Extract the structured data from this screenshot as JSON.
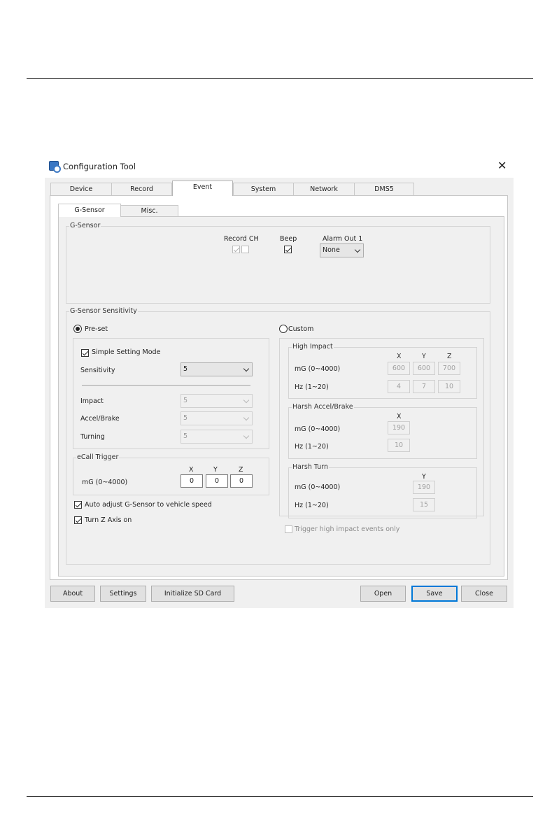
{
  "window": {
    "title": "Configuration Tool",
    "icon": "app-gear-icon"
  },
  "tabs": [
    "Device",
    "Record",
    "Event",
    "System",
    "Network",
    "DMS5"
  ],
  "active_tab": "Event",
  "subtabs": [
    "G-Sensor",
    "Misc."
  ],
  "active_subtab": "G-Sensor",
  "gsensor_group": {
    "label": "G-Sensor",
    "record_ch_label": "Record CH",
    "record_ch": [
      true,
      false
    ],
    "beep_label": "Beep",
    "beep": true,
    "alarm_label": "Alarm Out 1",
    "alarm_value": "None"
  },
  "sensitivity_group": {
    "label": "G-Sensor Sensitivity",
    "preset_label": "Pre-set",
    "preset_selected": true,
    "custom_label": "Custom",
    "custom_selected": false,
    "simple_mode_label": "Simple Setting Mode",
    "simple_mode": true,
    "sensitivity_label": "Sensitivity",
    "sensitivity_value": "5",
    "impact_label": "Impact",
    "impact_value": "5",
    "accel_label": "Accel/Brake",
    "accel_value": "5",
    "turning_label": "Turning",
    "turning_value": "5",
    "ecall": {
      "label": "eCall Trigger",
      "row_label": "mG (0~4000)",
      "x_label": "X",
      "y_label": "Y",
      "z_label": "Z",
      "x": "0",
      "y": "0",
      "z": "0"
    },
    "auto_adjust_label": "Auto adjust G-Sensor to vehicle speed",
    "auto_adjust": true,
    "z_axis_label": "Turn Z Axis on",
    "z_axis": true
  },
  "custom": {
    "high_impact": {
      "label": "High Impact",
      "x_label": "X",
      "y_label": "Y",
      "z_label": "Z",
      "mg_label": "mG (0~4000)",
      "hz_label": "Hz (1~20)",
      "mg": [
        "600",
        "600",
        "700"
      ],
      "hz": [
        "4",
        "7",
        "10"
      ]
    },
    "harsh_accel": {
      "label": "Harsh Accel/Brake",
      "x_label": "X",
      "mg_label": "mG (0~4000)",
      "hz_label": "Hz (1~20)",
      "mg": "190",
      "hz": "10"
    },
    "harsh_turn": {
      "label": "Harsh Turn",
      "y_label": "Y",
      "mg_label": "mG (0~4000)",
      "hz_label": "Hz (1~20)",
      "mg": "190",
      "hz": "15"
    },
    "trigger_only_label": "Trigger high impact events only",
    "trigger_only": false
  },
  "buttons": {
    "about": "About",
    "settings": "Settings",
    "init_sd": "Initialize SD Card",
    "open": "Open",
    "save": "Save",
    "close": "Close"
  }
}
